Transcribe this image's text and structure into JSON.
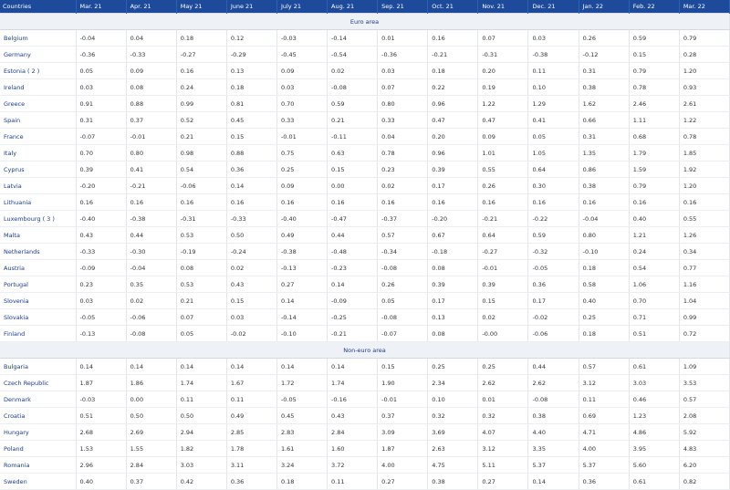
{
  "header": {
    "columns": [
      "Countries",
      "Mar. 21",
      "Apr. 21",
      "May 21",
      "June 21",
      "July 21",
      "Aug. 21",
      "Sep. 21",
      "Oct. 21",
      "Nov. 21",
      "Dec. 21",
      "Jan. 22",
      "Feb. 22",
      "Mar. 22"
    ]
  },
  "sections": [
    {
      "title": "Euro area",
      "rows": [
        {
          "country": "Belgium",
          "values": [
            "-0.04",
            "0.04",
            "0.18",
            "0.12",
            "-0.03",
            "-0.14",
            "0.01",
            "0.16",
            "0.07",
            "0.03",
            "0.26",
            "0.59",
            "0.79"
          ]
        },
        {
          "country": "Germany",
          "values": [
            "-0.36",
            "-0.33",
            "-0.27",
            "-0.29",
            "-0.45",
            "-0.54",
            "-0.36",
            "-0.21",
            "-0.31",
            "-0.38",
            "-0.12",
            "0.15",
            "0.28"
          ]
        },
        {
          "country": "Estonia ( 2 )",
          "values": [
            "0.05",
            "0.09",
            "0.16",
            "0.13",
            "0.09",
            "0.02",
            "0.03",
            "0.18",
            "0.20",
            "0.11",
            "0.31",
            "0.79",
            "1.20"
          ]
        },
        {
          "country": "Ireland",
          "values": [
            "0.03",
            "0.08",
            "0.24",
            "0.18",
            "0.03",
            "-0.08",
            "0.07",
            "0.22",
            "0.19",
            "0.10",
            "0.38",
            "0.78",
            "0.93"
          ]
        },
        {
          "country": "Greece",
          "values": [
            "0.91",
            "0.88",
            "0.99",
            "0.81",
            "0.70",
            "0.59",
            "0.80",
            "0.96",
            "1.22",
            "1.29",
            "1.62",
            "2.46",
            "2.61"
          ]
        },
        {
          "country": "Spain",
          "values": [
            "0.31",
            "0.37",
            "0.52",
            "0.45",
            "0.33",
            "0.21",
            "0.33",
            "0.47",
            "0.47",
            "0.41",
            "0.66",
            "1.11",
            "1.22"
          ]
        },
        {
          "country": "France",
          "values": [
            "-0.07",
            "-0.01",
            "0.21",
            "0.15",
            "-0.01",
            "-0.11",
            "0.04",
            "0.20",
            "0.09",
            "0.05",
            "0.31",
            "0.68",
            "0.78"
          ]
        },
        {
          "country": "Italy",
          "values": [
            "0.70",
            "0.80",
            "0.98",
            "0.88",
            "0.75",
            "0.63",
            "0.78",
            "0.96",
            "1.01",
            "1.05",
            "1.35",
            "1.79",
            "1.85"
          ]
        },
        {
          "country": "Cyprus",
          "values": [
            "0.39",
            "0.41",
            "0.54",
            "0.36",
            "0.25",
            "0.15",
            "0.23",
            "0.39",
            "0.55",
            "0.64",
            "0.86",
            "1.59",
            "1.92"
          ]
        },
        {
          "country": "Latvia",
          "values": [
            "-0.20",
            "-0.21",
            "-0.06",
            "0.14",
            "0.09",
            "0.00",
            "0.02",
            "0.17",
            "0.26",
            "0.30",
            "0.38",
            "0.79",
            "1.20"
          ]
        },
        {
          "country": "Lithuania",
          "values": [
            "0.16",
            "0.16",
            "0.16",
            "0.16",
            "0.16",
            "0.16",
            "0.16",
            "0.16",
            "0.16",
            "0.16",
            "0.16",
            "0.16",
            "0.16"
          ]
        },
        {
          "country": "Luxembourg ( 3 )",
          "values": [
            "-0.40",
            "-0.38",
            "-0.31",
            "-0.33",
            "-0.40",
            "-0.47",
            "-0.37",
            "-0.20",
            "-0.21",
            "-0.22",
            "-0.04",
            "0.40",
            "0.55"
          ]
        },
        {
          "country": "Malta",
          "values": [
            "0.43",
            "0.44",
            "0.53",
            "0.50",
            "0.49",
            "0.44",
            "0.57",
            "0.67",
            "0.64",
            "0.59",
            "0.80",
            "1.21",
            "1.26"
          ]
        },
        {
          "country": "Netherlands",
          "values": [
            "-0.33",
            "-0.30",
            "-0.19",
            "-0.24",
            "-0.38",
            "-0.48",
            "-0.34",
            "-0.18",
            "-0.27",
            "-0.32",
            "-0.10",
            "0.24",
            "0.34"
          ]
        },
        {
          "country": "Austria",
          "values": [
            "-0.09",
            "-0.04",
            "0.08",
            "0.02",
            "-0.13",
            "-0.23",
            "-0.08",
            "0.08",
            "-0.01",
            "-0.05",
            "0.18",
            "0.54",
            "0.77"
          ]
        },
        {
          "country": "Portugal",
          "values": [
            "0.23",
            "0.35",
            "0.53",
            "0.43",
            "0.27",
            "0.14",
            "0.26",
            "0.39",
            "0.39",
            "0.36",
            "0.58",
            "1.06",
            "1.16"
          ]
        },
        {
          "country": "Slovenia",
          "values": [
            "0.03",
            "0.02",
            "0.21",
            "0.15",
            "0.14",
            "-0.09",
            "0.05",
            "0.17",
            "0.15",
            "0.17",
            "0.40",
            "0.70",
            "1.04"
          ]
        },
        {
          "country": "Slovakia",
          "values": [
            "-0.05",
            "-0.06",
            "0.07",
            "0.03",
            "-0.14",
            "-0.25",
            "-0.08",
            "0.13",
            "0.02",
            "-0.02",
            "0.25",
            "0.71",
            "0.99"
          ]
        },
        {
          "country": "Finland",
          "values": [
            "-0.13",
            "-0.08",
            "0.05",
            "-0.02",
            "-0.10",
            "-0.21",
            "-0.07",
            "0.08",
            "-0.00",
            "-0.06",
            "0.18",
            "0.51",
            "0.72"
          ]
        }
      ]
    },
    {
      "title": "Non-euro area",
      "rows": [
        {
          "country": "Bulgaria",
          "values": [
            "0.14",
            "0.14",
            "0.14",
            "0.14",
            "0.14",
            "0.14",
            "0.15",
            "0.25",
            "0.25",
            "0.44",
            "0.57",
            "0.61",
            "1.09"
          ]
        },
        {
          "country": "Czech Republic",
          "values": [
            "1.87",
            "1.86",
            "1.74",
            "1.67",
            "1.72",
            "1.74",
            "1.90",
            "2.34",
            "2.62",
            "2.62",
            "3.12",
            "3.03",
            "3.53"
          ]
        },
        {
          "country": "Denmark",
          "values": [
            "-0.03",
            "0.00",
            "0.11",
            "0.11",
            "-0.05",
            "-0.16",
            "-0.01",
            "0.10",
            "0.01",
            "-0.08",
            "0.11",
            "0.46",
            "0.57"
          ]
        },
        {
          "country": "Croatia",
          "values": [
            "0.51",
            "0.50",
            "0.50",
            "0.49",
            "0.45",
            "0.43",
            "0.37",
            "0.32",
            "0.32",
            "0.38",
            "0.69",
            "1.23",
            "2.08"
          ]
        },
        {
          "country": "Hungary",
          "values": [
            "2.68",
            "2.69",
            "2.94",
            "2.85",
            "2.83",
            "2.84",
            "3.09",
            "3.69",
            "4.07",
            "4.40",
            "4.71",
            "4.86",
            "5.92"
          ]
        },
        {
          "country": "Poland",
          "values": [
            "1.53",
            "1.55",
            "1.82",
            "1.78",
            "1.61",
            "1.60",
            "1.87",
            "2.63",
            "3.12",
            "3.35",
            "4.00",
            "3.95",
            "4.83"
          ]
        },
        {
          "country": "Romania",
          "values": [
            "2.96",
            "2.84",
            "3.03",
            "3.11",
            "3.24",
            "3.72",
            "4.00",
            "4.75",
            "5.11",
            "5.37",
            "5.37",
            "5.60",
            "6.20"
          ]
        },
        {
          "country": "Sweden",
          "values": [
            "0.40",
            "0.37",
            "0.42",
            "0.36",
            "0.18",
            "0.11",
            "0.27",
            "0.38",
            "0.27",
            "0.14",
            "0.36",
            "0.61",
            "0.82"
          ]
        }
      ]
    }
  ]
}
